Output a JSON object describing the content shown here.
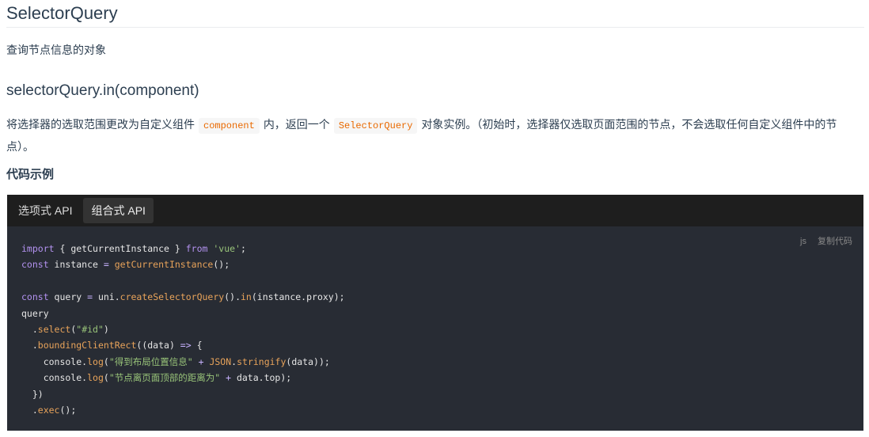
{
  "title": "SelectorQuery",
  "description": "查询节点信息的对象",
  "method_title": "selectorQuery.in(component)",
  "method_desc": {
    "part1": "将选择器的选取范围更改为自定义组件",
    "code1": "component",
    "part2": "内，返回一个",
    "code2": "SelectorQuery",
    "part3": "对象实例。（初始时，选择器仅选取页面范围的节点，不会选取任何自定义组件中的节点）。"
  },
  "example_title": "代码示例",
  "tabs": [
    {
      "label": "选项式 API",
      "active": false
    },
    {
      "label": "组合式 API",
      "active": true
    }
  ],
  "code_lang": "js",
  "copy_label": "复制代码",
  "code_lines": [
    "import { getCurrentInstance } from 'vue';",
    "const instance = getCurrentInstance();",
    "",
    "const query = uni.createSelectorQuery().in(instance.proxy);",
    "query",
    "  .select(\"#id\")",
    "  .boundingClientRect((data) => {",
    "    console.log(\"得到布局位置信息\" + JSON.stringify(data));",
    "    console.log(\"节点离页面顶部的距离为\" + data.top);",
    "  })",
    "  .exec();"
  ]
}
